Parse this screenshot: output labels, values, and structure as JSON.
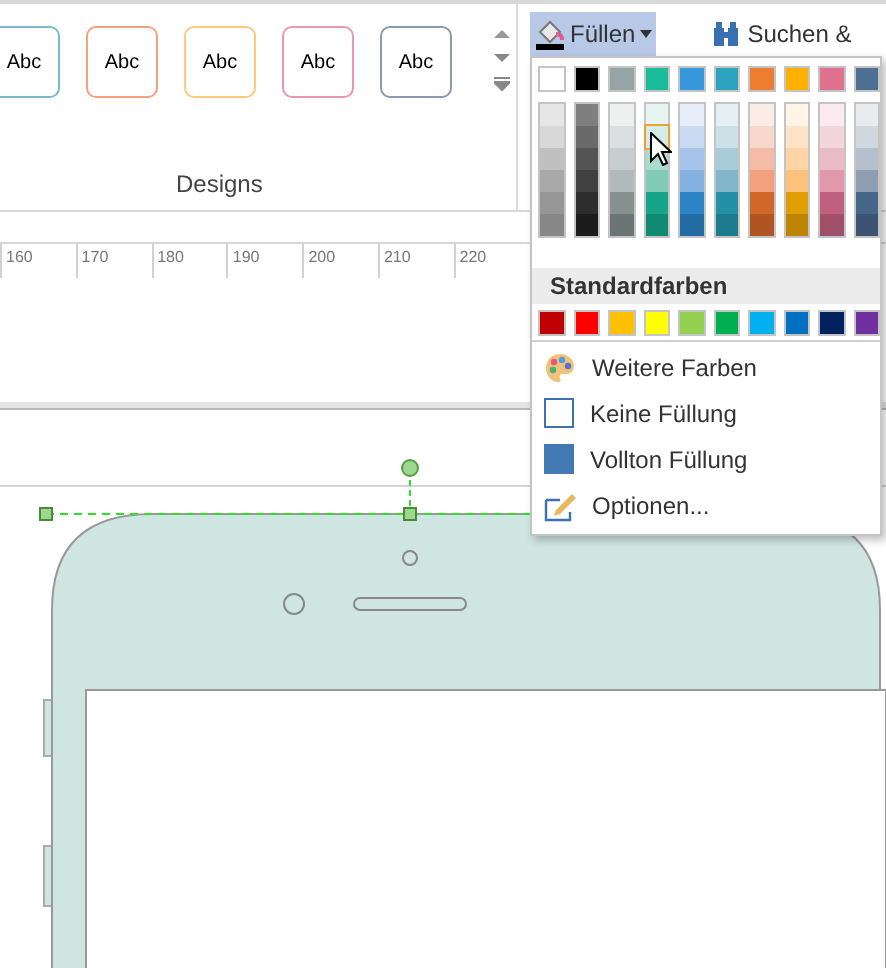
{
  "designs": {
    "label": "Designs",
    "styles": [
      {
        "text": "Abc",
        "color": "#7ab8d0"
      },
      {
        "text": "Abc",
        "color": "#f5a080"
      },
      {
        "text": "Abc",
        "color": "#ffc880"
      },
      {
        "text": "Abc",
        "color": "#e898b0"
      },
      {
        "text": "Abc",
        "color": "#8a9ab0"
      }
    ]
  },
  "toolbar": {
    "fill_button": {
      "label": "Füllen",
      "expanded": true
    },
    "find_button": {
      "label": "Suchen &"
    }
  },
  "ruler": {
    "ticks": [
      "160",
      "170",
      "180",
      "190",
      "200",
      "210",
      "220"
    ]
  },
  "fill_menu": {
    "theme_colors": [
      {
        "color": "#ffffff",
        "shades": [
          {
            "color": "#e6e6e6",
            "selected": false
          },
          {
            "color": "#d8d8d8",
            "selected": false
          },
          {
            "color": "#c0c0c0",
            "selected": false
          },
          {
            "color": "#a9a9a9",
            "selected": false
          },
          {
            "color": "#969696",
            "selected": false
          },
          {
            "color": "#878787",
            "selected": false
          }
        ]
      },
      {
        "color": "#000000",
        "shades": [
          {
            "color": "#7f7f7f",
            "selected": false
          },
          {
            "color": "#6a6a6a",
            "selected": false
          },
          {
            "color": "#545454",
            "selected": false
          },
          {
            "color": "#404040",
            "selected": false
          },
          {
            "color": "#2d2d2d",
            "selected": false
          },
          {
            "color": "#1c1c1c",
            "selected": false
          }
        ]
      },
      {
        "color": "#95a5a6",
        "shades": [
          {
            "color": "#eef0f0",
            "selected": false
          },
          {
            "color": "#dcdfe0",
            "selected": false
          },
          {
            "color": "#c8cecf",
            "selected": false
          },
          {
            "color": "#b2b9ba",
            "selected": false
          },
          {
            "color": "#86908f",
            "selected": false
          },
          {
            "color": "#6b7574",
            "selected": false
          }
        ]
      },
      {
        "color": "#1abc9c",
        "shades": [
          {
            "color": "#e6f5f1",
            "selected": false
          },
          {
            "color": "#d4ece6",
            "selected": true
          },
          {
            "color": "#a9dccd",
            "selected": false
          },
          {
            "color": "#82ccb6",
            "selected": false
          },
          {
            "color": "#17a589",
            "selected": false
          },
          {
            "color": "#118a72",
            "selected": false
          }
        ]
      },
      {
        "color": "#3498db",
        "shades": [
          {
            "color": "#e6eef9",
            "selected": false
          },
          {
            "color": "#c9dbf2",
            "selected": false
          },
          {
            "color": "#a6c4ea",
            "selected": false
          },
          {
            "color": "#85b1e0",
            "selected": false
          },
          {
            "color": "#2c83c6",
            "selected": false
          },
          {
            "color": "#236ca3",
            "selected": false
          }
        ]
      },
      {
        "color": "#2ea3c0",
        "shades": [
          {
            "color": "#e6f0f3",
            "selected": false
          },
          {
            "color": "#cce1e7",
            "selected": false
          },
          {
            "color": "#a8cbd8",
            "selected": false
          },
          {
            "color": "#82b7cb",
            "selected": false
          },
          {
            "color": "#2490a8",
            "selected": false
          },
          {
            "color": "#1e7a8e",
            "selected": false
          }
        ]
      },
      {
        "color": "#ed7d31",
        "shades": [
          {
            "color": "#fcece6",
            "selected": false
          },
          {
            "color": "#f8d8cc",
            "selected": false
          },
          {
            "color": "#f4bca6",
            "selected": false
          },
          {
            "color": "#f2a07e",
            "selected": false
          },
          {
            "color": "#d2672a",
            "selected": false
          },
          {
            "color": "#ae5521",
            "selected": false
          }
        ]
      },
      {
        "color": "#ffb000",
        "shades": [
          {
            "color": "#fff4e6",
            "selected": false
          },
          {
            "color": "#ffe3c6",
            "selected": false
          },
          {
            "color": "#ffd4a6",
            "selected": false
          },
          {
            "color": "#ffc27a",
            "selected": false
          },
          {
            "color": "#e09e00",
            "selected": false
          },
          {
            "color": "#bd8400",
            "selected": false
          }
        ]
      },
      {
        "color": "#e07090",
        "shades": [
          {
            "color": "#fbeaf0",
            "selected": false
          },
          {
            "color": "#f2d5dd",
            "selected": false
          },
          {
            "color": "#ebbac8",
            "selected": false
          },
          {
            "color": "#e197ac",
            "selected": false
          },
          {
            "color": "#c06080",
            "selected": false
          },
          {
            "color": "#a05068",
            "selected": false
          }
        ]
      },
      {
        "color": "#4d6f94",
        "shades": [
          {
            "color": "#e9ebee",
            "selected": false
          },
          {
            "color": "#d2d7df",
            "selected": false
          },
          {
            "color": "#b5bfcc",
            "selected": false
          },
          {
            "color": "#8e9db2",
            "selected": false
          },
          {
            "color": "#456589",
            "selected": false
          },
          {
            "color": "#3c5371",
            "selected": false
          }
        ]
      }
    ],
    "standard_label": "Standardfarben",
    "standard_colors": [
      {
        "color": "#c00000"
      },
      {
        "color": "#ff0000"
      },
      {
        "color": "#ffc000"
      },
      {
        "color": "#ffff00"
      },
      {
        "color": "#92d050"
      },
      {
        "color": "#00b050"
      },
      {
        "color": "#00b0f0"
      },
      {
        "color": "#0070c0"
      },
      {
        "color": "#002060"
      },
      {
        "color": "#7030a0"
      }
    ],
    "items": [
      {
        "kind": "palette",
        "label": "Weitere Farben"
      },
      {
        "kind": "none",
        "label": "Keine Füllung"
      },
      {
        "kind": "solid",
        "label": "Vollton Füllung"
      },
      {
        "kind": "options",
        "label": "Optionen..."
      }
    ]
  }
}
